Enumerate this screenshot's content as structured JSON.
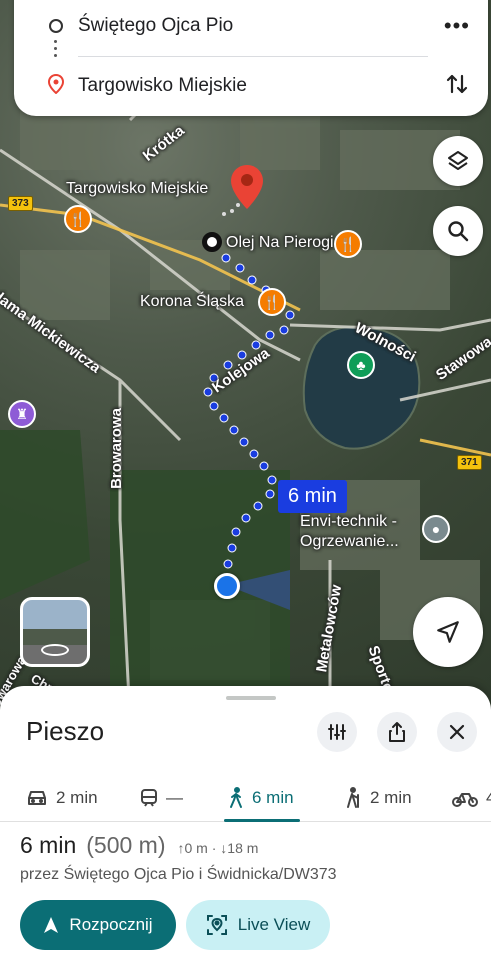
{
  "route": {
    "origin": "Świętego Ojca Pio",
    "destination": "Targowisko Miejskie",
    "more_icon": "more-horizontal-icon",
    "swap_icon": "swap-vertical-icon"
  },
  "map": {
    "streets": [
      "Krótka",
      "Adama Mickiewicza",
      "Kolejowa",
      "Wolności",
      "Stawowa",
      "Browarowa",
      "Metalowców",
      "Sportowa",
      "Browarowa",
      "Chr..."
    ],
    "pois": {
      "destination": "Targowisko Miejskie",
      "restaurant1": "Olej Na Pierogi",
      "restaurant2": "Korona Śląska",
      "company": "Envi-technik - Ogrzewanie..."
    },
    "road_shields": [
      "373",
      "371"
    ],
    "route_time": "6 min"
  },
  "sheet": {
    "title": "Pieszo",
    "modes": [
      {
        "icon": "car-icon",
        "label": "2 min"
      },
      {
        "icon": "transit-icon",
        "label": "—"
      },
      {
        "icon": "walk-icon",
        "label": "6 min"
      },
      {
        "icon": "wheelchair-walk-icon",
        "label": "2 min"
      },
      {
        "icon": "bike-icon",
        "label": "4"
      }
    ],
    "summary_time": "6 min",
    "summary_distance": "(500 m)",
    "elevation": "↑0 m · ↓18 m",
    "via": "przez Świętego Ojca Pio i Świdnicka/DW373",
    "start_label": "Rozpocznij",
    "live_view_label": "Live View"
  },
  "colors": {
    "accent": "#0b6e75",
    "route": "#1a3de0",
    "live_view_bg": "#c9f0f4"
  }
}
